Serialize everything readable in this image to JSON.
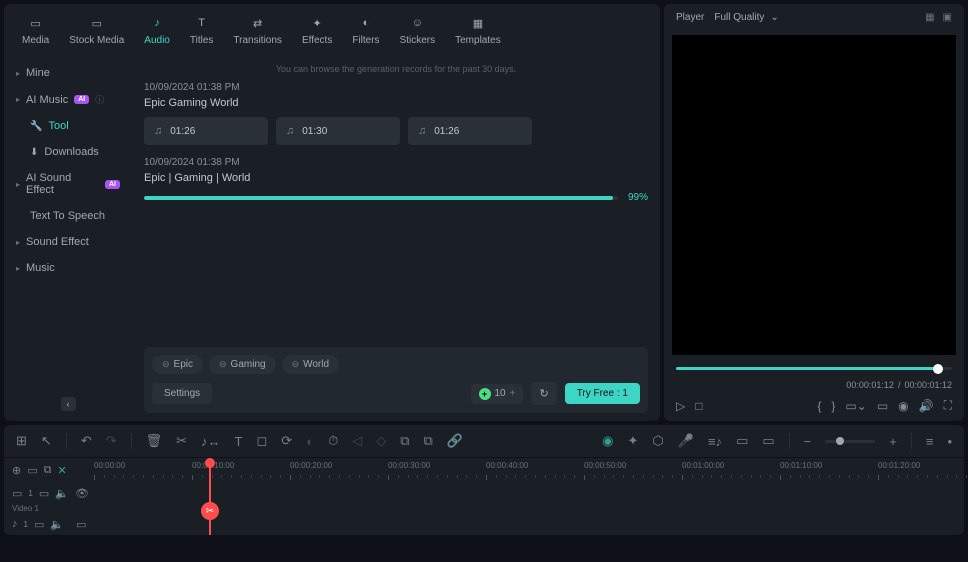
{
  "tabs": [
    "Media",
    "Stock Media",
    "Audio",
    "Titles",
    "Transitions",
    "Effects",
    "Filters",
    "Stickers",
    "Templates"
  ],
  "activeTab": 2,
  "sidebar": {
    "items": [
      {
        "label": "Mine",
        "arrow": true
      },
      {
        "label": "AI Music",
        "arrow": true,
        "ai": true,
        "info": true
      },
      {
        "label": "Tool",
        "indent": true,
        "active": true
      },
      {
        "label": "Downloads",
        "indent": true
      },
      {
        "label": "AI Sound Effect",
        "arrow": true,
        "ai": true
      },
      {
        "label": "Text To Speech",
        "indent": true
      },
      {
        "label": "Sound Effect",
        "arrow": true
      },
      {
        "label": "Music",
        "arrow": true
      }
    ]
  },
  "hint": "You can browse the generation records for the past 30 days.",
  "gens": [
    {
      "ts": "10/09/2024 01:38 PM",
      "title": "Epic Gaming World",
      "clips": [
        "01:26",
        "01:30",
        "01:26"
      ]
    },
    {
      "ts": "10/09/2024 01:38 PM",
      "title": "Epic | Gaming | World",
      "progress": 99
    }
  ],
  "tags": [
    "Epic",
    "Gaming",
    "World"
  ],
  "settings_label": "Settings",
  "credits": {
    "value": "10"
  },
  "try_label": "Try Free : 1",
  "preview": {
    "title": "Player",
    "quality": "Full Quality",
    "current": "00:00:01:12",
    "total": "00:00:01:12"
  },
  "timeline": {
    "ticks": [
      "00:00:00",
      "00:00:10:00",
      "00:00:20:00",
      "00:00:30:00",
      "00:00:40:00",
      "00:00:50:00",
      "00:01:00:00",
      "00:01:10:00",
      "00:01:20:00"
    ],
    "track1_label": "Video 1",
    "track1_num": "1",
    "track2_num": "1"
  }
}
